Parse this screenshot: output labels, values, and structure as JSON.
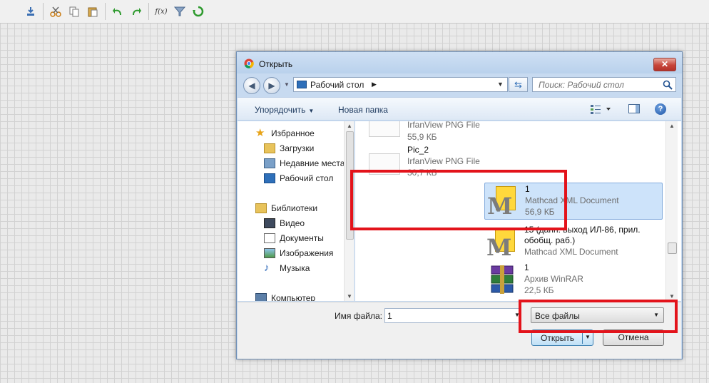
{
  "app_toolbar": {
    "fx_label": "f(x)"
  },
  "dialog": {
    "title": "Открыть",
    "close_label": "✕",
    "address": {
      "current": "Рабочий стол"
    },
    "search": {
      "placeholder": "Поиск: Рабочий стол"
    },
    "commands": {
      "organize": "Упорядочить",
      "new_folder": "Новая папка"
    },
    "nav": {
      "favorites": "Избранное",
      "items": [
        "Загрузки",
        "Недавние места",
        "Рабочий стол"
      ],
      "libraries": "Библиотеки",
      "lib_items": [
        "Видео",
        "Документы",
        "Изображения",
        "Музыка"
      ],
      "computer": "Компьютер"
    },
    "files": [
      {
        "name": "",
        "type": "IrfanView PNG File",
        "size": "55,9 КБ"
      },
      {
        "name": "Pic_2",
        "type": "IrfanView PNG File",
        "size": "30,7 КБ"
      },
      {
        "name": "1",
        "type": "Mathcad XML Document",
        "size": "56,9 КБ"
      },
      {
        "name": "15 (данн. выход ИЛ-86, прил. обобщ. раб.)",
        "type": "Mathcad XML Document",
        "size": ""
      },
      {
        "name": "1",
        "type": "Архив WinRAR",
        "size": "22,5 КБ"
      }
    ],
    "filename": {
      "label": "Имя файла:",
      "value": "1"
    },
    "filter": {
      "selected": "Все файлы"
    },
    "buttons": {
      "open": "Открыть",
      "cancel": "Отмена"
    }
  },
  "colors": {
    "annotation_red": "#e3131b",
    "selection": "#cde3fa"
  }
}
